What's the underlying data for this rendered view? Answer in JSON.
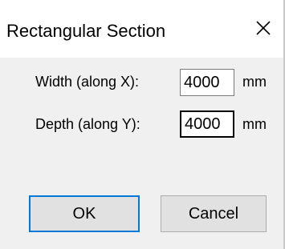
{
  "dialog": {
    "title": "Rectangular Section",
    "fields": [
      {
        "label": "Width (along X):",
        "value": "4000",
        "unit": "mm"
      },
      {
        "label": "Depth (along Y):",
        "value": "4000",
        "unit": "mm"
      }
    ],
    "buttons": {
      "ok": "OK",
      "cancel": "Cancel"
    }
  },
  "icons": {
    "close": "close-icon"
  },
  "colors": {
    "title_bg": "#ffffff",
    "client_bg": "#f0f0f0",
    "button_bg": "#e1e1e1",
    "default_button_border": "#0078d7"
  }
}
